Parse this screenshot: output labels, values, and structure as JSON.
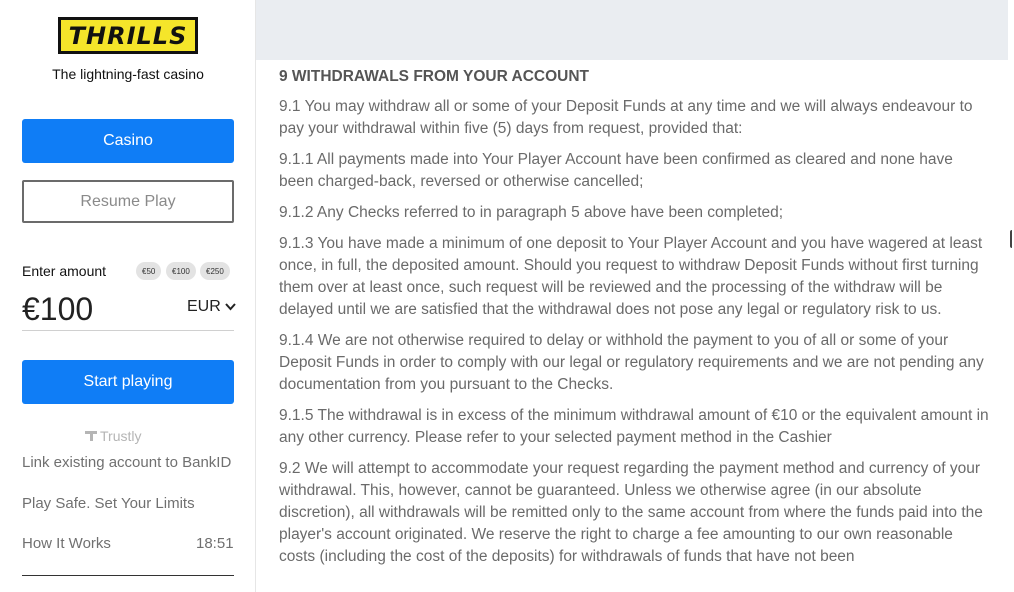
{
  "sidebar": {
    "logo_text": "THRILLS",
    "tagline": "The lightning-fast casino",
    "casino_button": "Casino",
    "resume_button": "Resume Play",
    "enter_amount_label": "Enter amount",
    "chips": [
      "€50",
      "€100",
      "€250"
    ],
    "amount_value": "€100",
    "currency": "EUR",
    "start_button": "Start playing",
    "trustly_label": "Trustly",
    "links": {
      "bankid": "Link existing account to BankID",
      "play_safe": "Play Safe. Set Your Limits",
      "how_it_works": "How It Works"
    },
    "clock": "18:51"
  },
  "main": {
    "heading": "9 WITHDRAWALS FROM YOUR ACCOUNT",
    "paragraphs": [
      "9.1 You may withdraw all or some of your Deposit Funds at any time and we will always endeavour to pay your withdrawal within five (5) days from request, provided that:",
      "9.1.1 All payments made into Your Player Account have been confirmed as cleared and none have been charged-back, reversed or otherwise cancelled;",
      "9.1.2 Any Checks referred to in paragraph 5 above have been completed;",
      "9.1.3 You have made a minimum of one deposit to Your Player Account and you have wagered at least once, in full, the deposited amount. Should you request to withdraw Deposit Funds without first turning them over at least once, such request will be reviewed and the processing of the withdraw will be delayed until we are satisfied that the withdrawal does not pose any legal or regulatory risk to us.",
      "9.1.4 We are not otherwise required to delay or withhold the payment to you of all or some of your Deposit Funds in order to comply with our legal or regulatory requirements and we are not pending any documentation from you pursuant to the Checks.",
      "9.1.5 The withdrawal is in excess of the minimum withdrawal amount of €10 or the equivalent amount in any other currency. Please refer to your selected payment method in the Cashier",
      "9.2 We will attempt to accommodate your request regarding the payment method and currency of your withdrawal. This, however, cannot be guaranteed. Unless we otherwise agree (in our absolute discretion), all withdrawals will be remitted only to the same account from where the funds paid into the player's account originated. We reserve the right to charge a fee amounting to our own reasonable costs (including the cost of the deposits) for withdrawals of funds that have not been"
    ]
  },
  "colors": {
    "accent": "#0f7df6",
    "logo_yellow": "#f5e52a",
    "top_band": "#eaedf1"
  }
}
